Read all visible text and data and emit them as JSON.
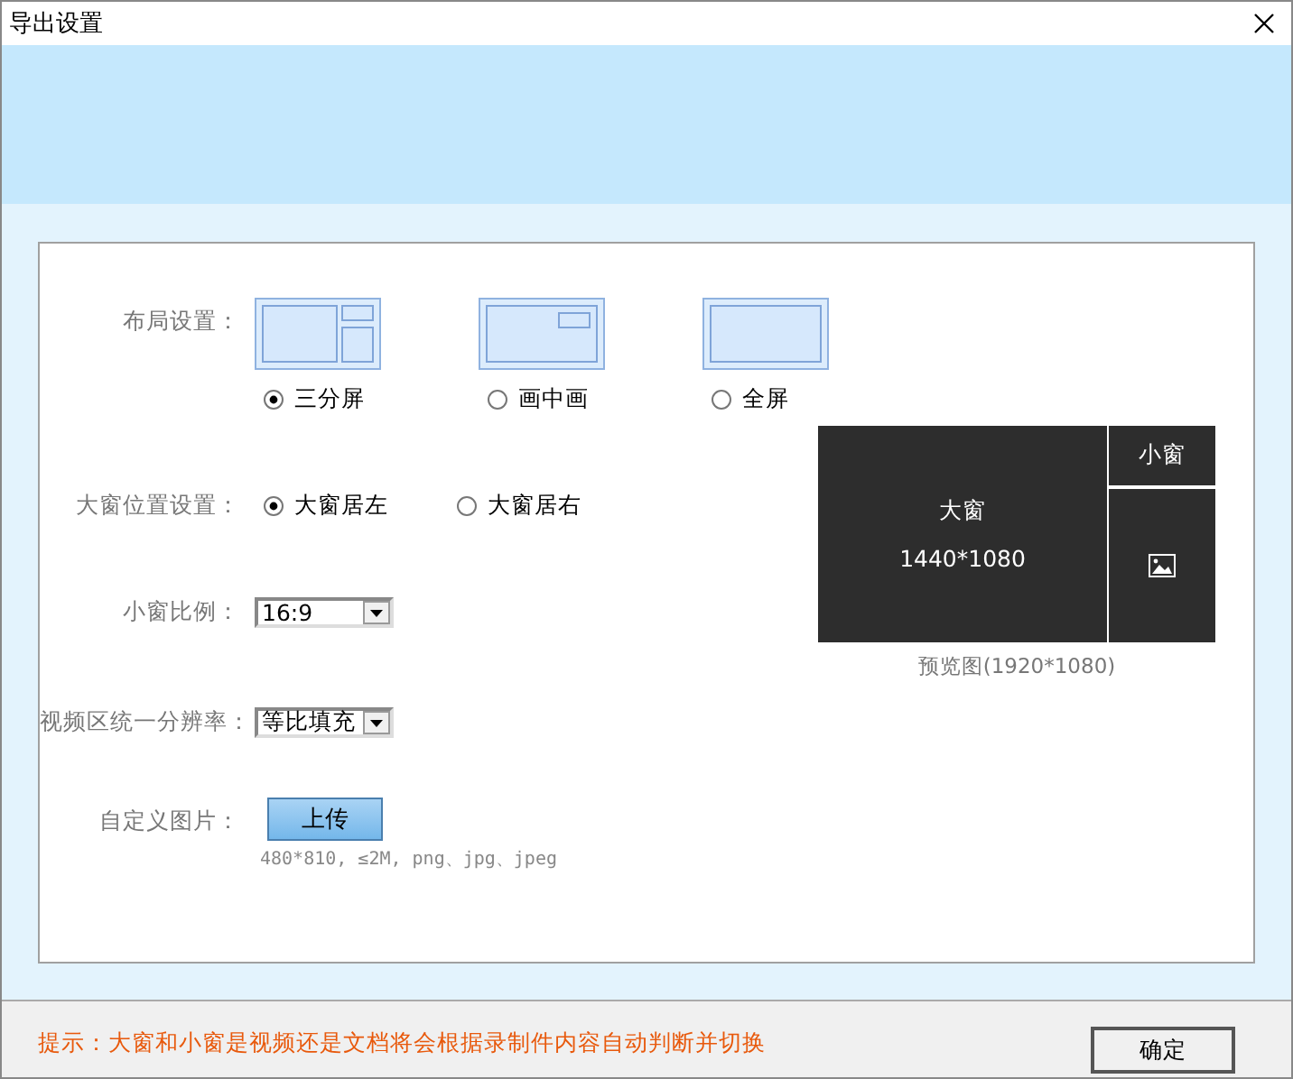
{
  "window": {
    "title": "导出设置"
  },
  "layout": {
    "label": "布局设置：",
    "options": [
      {
        "kind": "three",
        "label": "三分屏",
        "selected": true
      },
      {
        "kind": "pip",
        "label": "画中画",
        "selected": false
      },
      {
        "kind": "full",
        "label": "全屏",
        "selected": false
      }
    ]
  },
  "position": {
    "label": "大窗位置设置：",
    "options": [
      {
        "label": "大窗居左",
        "selected": true
      },
      {
        "label": "大窗居右",
        "selected": false
      }
    ]
  },
  "ratio": {
    "label": "小窗比例：",
    "value": "16:9"
  },
  "resolution": {
    "label": "视频区统一分辨率：",
    "value": "等比填充"
  },
  "custom_image": {
    "label": "自定义图片：",
    "button": "上传",
    "hint": "480*810, ≤2M, png、jpg、jpeg"
  },
  "preview": {
    "big": "大窗",
    "big_size": "1440*1080",
    "small": "小窗",
    "caption": "预览图(1920*1080)"
  },
  "footer": {
    "hint": "提示：大窗和小窗是视频还是文档将会根据录制件内容自动判断并切换",
    "ok": "确定"
  }
}
